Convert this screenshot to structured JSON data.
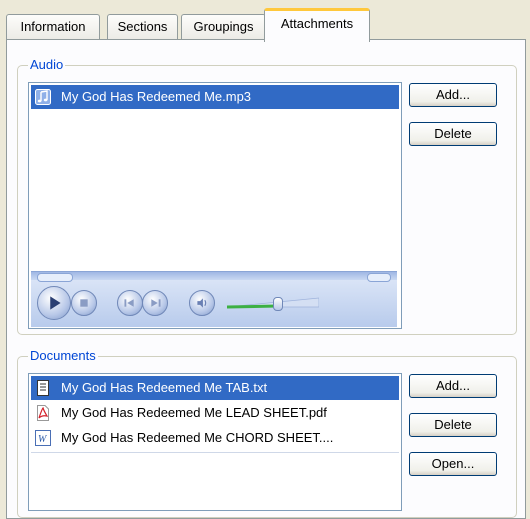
{
  "tabs": [
    {
      "label": "Information"
    },
    {
      "label": "Sections"
    },
    {
      "label": "Groupings"
    },
    {
      "label": "Attachments",
      "active": true
    }
  ],
  "audio": {
    "title": "Audio",
    "items": [
      {
        "name": "My God Has Redeemed Me.mp3",
        "icon": "music-file-icon",
        "selected": true
      }
    ],
    "add_label": "Add...",
    "delete_label": "Delete",
    "player": {
      "controls": [
        "play-icon",
        "stop-icon",
        "previous-icon",
        "next-icon",
        "mute-icon"
      ],
      "volume_level": 0.55
    }
  },
  "documents": {
    "title": "Documents",
    "items": [
      {
        "name": "My God Has Redeemed Me TAB.txt",
        "icon": "text-file-icon",
        "selected": true
      },
      {
        "name": "My God Has Redeemed Me LEAD SHEET.pdf",
        "icon": "pdf-file-icon",
        "selected": false
      },
      {
        "name": "My God Has Redeemed Me CHORD SHEET....",
        "icon": "word-file-icon",
        "selected": false
      }
    ],
    "add_label": "Add...",
    "delete_label": "Delete",
    "open_label": "Open..."
  },
  "colors": {
    "selection": "#316ac5",
    "group_title": "#0046d5",
    "active_tab_accent": "#ffc83c"
  }
}
